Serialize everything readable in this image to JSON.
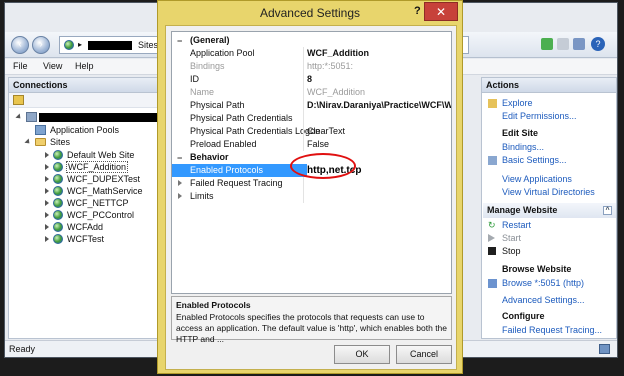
{
  "window": {
    "address_text": "Sites",
    "menu": [
      "File",
      "View",
      "Help"
    ],
    "status": "Ready"
  },
  "connections": {
    "title": "Connections",
    "tree": {
      "app_pools": "Application Pools",
      "sites": "Sites",
      "site_list": [
        "Default Web Site",
        "WCF_Addition",
        "WCF_DUPEXTest",
        "WCF_MathService",
        "WCF_NETTCP",
        "WCF_PCControl",
        "WCFAdd",
        "WCFTest"
      ]
    }
  },
  "actions": {
    "title": "Actions",
    "explore": "Explore",
    "edit_permissions": "Edit Permissions...",
    "edit_site": "Edit Site",
    "bindings": "Bindings...",
    "basic_settings": "Basic Settings...",
    "view_applications": "View Applications",
    "view_virtual_dirs": "View Virtual Directories",
    "manage_website": "Manage Website",
    "restart": "Restart",
    "start": "Start",
    "stop": "Stop",
    "browse_website": "Browse Website",
    "browse_link": "Browse *:5051 (http)",
    "advanced_settings": "Advanced Settings...",
    "configure": "Configure",
    "failed_tracing": "Failed Request Tracing..."
  },
  "dialog": {
    "title": "Advanced Settings",
    "help": "?",
    "close": "✕",
    "general_category": "(General)",
    "app_pool_name": "Application Pool",
    "app_pool_value": "WCF_Addition",
    "bindings_name": "Bindings",
    "bindings_value": "http:*:5051:",
    "id_name": "ID",
    "id_value": "8",
    "name_name": "Name",
    "name_value": "WCF_Addition",
    "physical_path_name": "Physical Path",
    "physical_path_value": "D:\\Nirav.Daraniya\\Practice\\WCF\\WCF",
    "ppc_name": "Physical Path Credentials",
    "ppc_value": "",
    "ppcl_name": "Physical Path Credentials Logon",
    "ppcl_value": "ClearText",
    "preload_name": "Preload Enabled",
    "preload_value": "False",
    "behavior_category": "Behavior",
    "protocols_name": "Enabled Protocols",
    "protocols_value": "http,net.tcp",
    "frt_name": "Failed Request Tracing",
    "limits_name": "Limits",
    "desc_title": "Enabled Protocols",
    "desc_text": "Enabled Protocols specifies the protocols that requests can use to access an application. The default value is 'http', which enables both the HTTP and ...",
    "ok": "OK",
    "cancel": "Cancel"
  },
  "colors": {
    "dialog_frame": "#e8d56c",
    "selection": "#3399ff",
    "annotation": "#e01010",
    "link": "#1d5bbd"
  }
}
